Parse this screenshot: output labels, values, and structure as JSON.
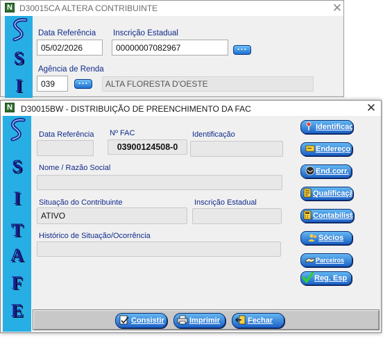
{
  "back_window": {
    "title": "D30015CA ALTERA CONTRIBUINTE",
    "app_icon": "N",
    "close_glyph": "✕",
    "data_referencia": {
      "label": "Data Referência",
      "value": "05/02/2026"
    },
    "inscricao_estadual": {
      "label": "Inscrição Estadual",
      "value": "00000007082967"
    },
    "agencia_renda": {
      "label": "Agência de Renda",
      "code": "039",
      "name": "ALTA FLORESTA D'OESTE"
    },
    "lookup_button_label": "...",
    "logo_letters": [
      "S",
      "I"
    ]
  },
  "front_window": {
    "title": "D30015BW - DISTRIBUIÇÃO DE PREENCHIMENTO DA FAC",
    "app_icon": "N",
    "close_glyph": "✕",
    "logo_letters": [
      "S",
      "I",
      "T",
      "A",
      "F",
      "E"
    ],
    "fields": {
      "data_referencia": {
        "label": "Data Referência",
        "value": ""
      },
      "n_fac": {
        "label": "Nº FAC",
        "value": "03900124508-0"
      },
      "identificacao": {
        "label": "Identificação",
        "value": ""
      },
      "nome_razao": {
        "label": "Nome / Razão Social",
        "value": ""
      },
      "situacao": {
        "label": "Situação do Contribuinte",
        "value": "ATIVO"
      },
      "inscricao_estadual": {
        "label": "Inscrição Estadual",
        "value": ""
      },
      "historico": {
        "label": "Histórico de Situação/Ocorrência",
        "value": ""
      }
    },
    "side_buttons": [
      {
        "label": "Identificação",
        "icon": "pin-icon"
      },
      {
        "label": "Endereço",
        "icon": "card-icon"
      },
      {
        "label": "End.corr.",
        "icon": "mail-icon"
      },
      {
        "label": "Qualificação",
        "icon": "document-icon"
      },
      {
        "label": "Contabilista",
        "icon": "calculator-icon"
      },
      {
        "label": "Sócios",
        "icon": "people-icon"
      },
      {
        "label": "Parceiros",
        "icon": "handshake-icon"
      },
      {
        "label": "Reg. Esp",
        "icon": "checkmark-icon"
      }
    ],
    "bottom_buttons": [
      {
        "label": "Consistir",
        "icon": "consist-icon"
      },
      {
        "label": "Imprimir",
        "icon": "printer-icon"
      },
      {
        "label": "Fechar",
        "icon": "exit-icon"
      }
    ]
  },
  "colors": {
    "logo_strip": "#27aee4",
    "logo_letters": "#1a1f8c",
    "button_blue": "#1c62c6",
    "label_blue": "#102a8a"
  }
}
